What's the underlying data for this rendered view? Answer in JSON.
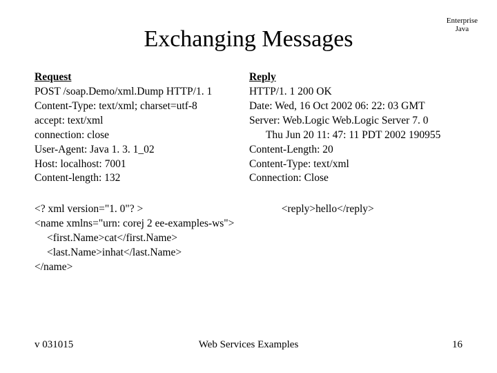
{
  "corner": {
    "line1": "Enterprise",
    "line2": "Java"
  },
  "title": "Exchanging Messages",
  "request": {
    "heading": "Request",
    "lines": [
      "POST /soap.Demo/xml.Dump HTTP/1. 1",
      "Content-Type: text/xml; charset=utf-8",
      "accept: text/xml",
      "connection: close",
      "User-Agent: Java 1. 3. 1_02",
      "Host: localhost: 7001",
      "Content-length: 132"
    ]
  },
  "reply": {
    "heading": "Reply",
    "lines": [
      "HTTP/1. 1 200 OK",
      "Date: Wed, 16 Oct 2002 06: 22: 03 GMT",
      "Server: Web.Logic Web.Logic Server 7. 0",
      "Thu Jun 20 11: 47: 11 PDT 2002 190955",
      "Content-Length: 20",
      "Content-Type: text/xml",
      "Connection: Close"
    ]
  },
  "xml_left": {
    "l1": "<? xml version=\"1. 0\"? >",
    "l2": "<name xmlns=\"urn: corej 2 ee-examples-ws\">",
    "l3": "<first.Name>cat</first.Name>",
    "l4": "<last.Name>inhat</last.Name>",
    "l5": "</name>"
  },
  "xml_right": "<reply>hello</reply>",
  "footer": {
    "left": "v 031015",
    "center": "Web Services Examples",
    "right": "16"
  }
}
